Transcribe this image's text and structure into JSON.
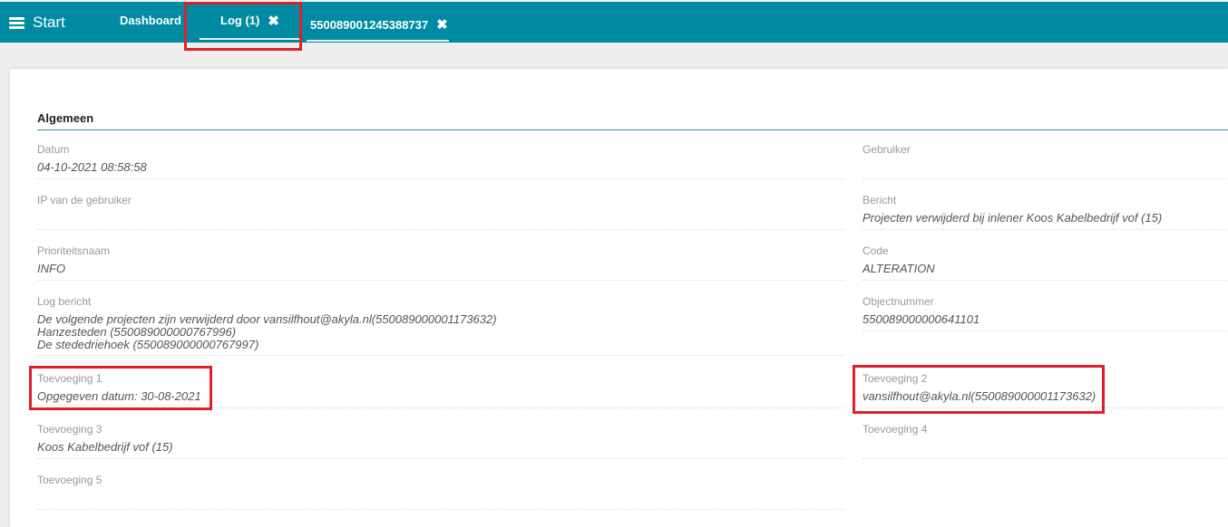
{
  "topbar": {
    "start_label": "Start",
    "tabs": [
      {
        "label": "Dashboard"
      },
      {
        "label": "Log (1)",
        "close": "✖"
      },
      {
        "label": "550089001245388737",
        "close": "✖"
      }
    ]
  },
  "section": {
    "title": "Algemeen"
  },
  "left_fields": [
    {
      "label": "Datum",
      "value": "04-10-2021 08:58:58"
    },
    {
      "label": "IP van de gebruiker",
      "value": ""
    },
    {
      "label": "Prioriteitsnaam",
      "value": "INFO"
    },
    {
      "label": "Log bericht",
      "lines": [
        "De volgende projecten zijn verwijderd door vansilfhout@akyla.nl(550089000001173632)",
        "Hanzesteden (550089000000767996)",
        "De stededriehoek (550089000000767997)"
      ]
    },
    {
      "label": "Toevoeging 1",
      "value": "Opgegeven datum: 30-08-2021"
    },
    {
      "label": "Toevoeging 3",
      "value": "Koos Kabelbedrijf vof (15)"
    },
    {
      "label": "Toevoeging 5",
      "value": ""
    }
  ],
  "right_fields": [
    {
      "label": "Gebruiker",
      "value": ""
    },
    {
      "label": "Bericht",
      "value": "Projecten verwijderd bij inlener Koos Kabelbedrijf vof (15)"
    },
    {
      "label": "Code",
      "value": "ALTERATION"
    },
    {
      "label": "Objectnummer",
      "value": "550089000000641101"
    },
    {
      "label": "Toevoeging 2",
      "value": "vansilfhout@akyla.nl(550089000001173632)"
    },
    {
      "label": "Toevoeging 4",
      "value": ""
    }
  ],
  "colors": {
    "header": "#008ba3",
    "highlight": "#e11f26"
  },
  "icons": {
    "menu": "hamburger-icon",
    "close": "close-icon"
  }
}
